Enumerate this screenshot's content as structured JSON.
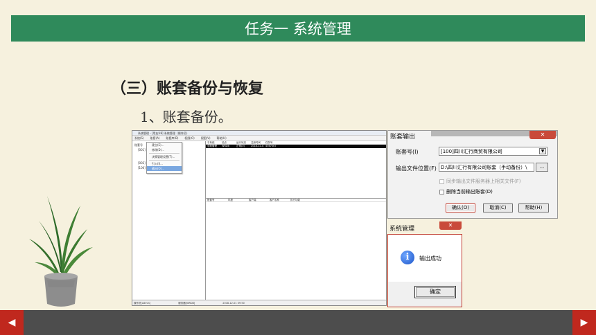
{
  "slide": {
    "title": "任务一 系统管理",
    "section_heading": "（三）账套备份与恢复",
    "sub_heading": "1、账套备份。"
  },
  "app": {
    "window_title": "系统管理 - [用友U8] 系统管理（操作员）",
    "menu": [
      "系统(S)",
      "账套(A)",
      "账套库(B)",
      "权限(O)",
      "视图(V)",
      "帮助(H)"
    ],
    "tree": [
      "账套号",
      "[001]",
      "[002]",
      "[100]"
    ],
    "context_menu": [
      "建立(E)...",
      "修改(D)...",
      "决策管理设置(T)...",
      "引入(I)...",
      "输出(O)..."
    ],
    "context_menu_active_index": 4,
    "grid_top_headers": [
      "子系统",
      "站点",
      "运行状态",
      "注册时间",
      "任务号"
    ],
    "grid_top_selected_row": [
      "总账管理",
      "WRD8",
      "正常(0)",
      "2018-12-01 09:49:06",
      "4367567"
    ],
    "grid_bottom_headers": [
      "账套号",
      "年度",
      "客户端",
      "客户名称",
      "执行功能"
    ],
    "status": [
      "操作员[admin]",
      "服务器[WRD8]",
      "2018-12-01 09:50"
    ]
  },
  "export_dialog": {
    "title": "账套输出",
    "close_glyph": "✕",
    "account_label": "账套号(I)",
    "account_value": "[100]四川汇行商贸有限公司",
    "path_label": "输出文件位置(F)",
    "path_value": "D:\\四川汇行有限公司账套（手动备份）\\",
    "browse_label": "...",
    "sync_label": "同步输出文件服务器上相关文件(F)",
    "delete_label": "删除当前输出账套(D)",
    "confirm_label": "确认(O)",
    "cancel_label": "取消(C)",
    "help_label": "帮助(H)"
  },
  "success_dialog": {
    "title": "系统管理",
    "close_glyph": "✕",
    "icon_glyph": "i",
    "message": "输出成功",
    "ok_label": "确定"
  },
  "nav": {
    "prev_glyph": "◀",
    "next_glyph": "▶"
  }
}
